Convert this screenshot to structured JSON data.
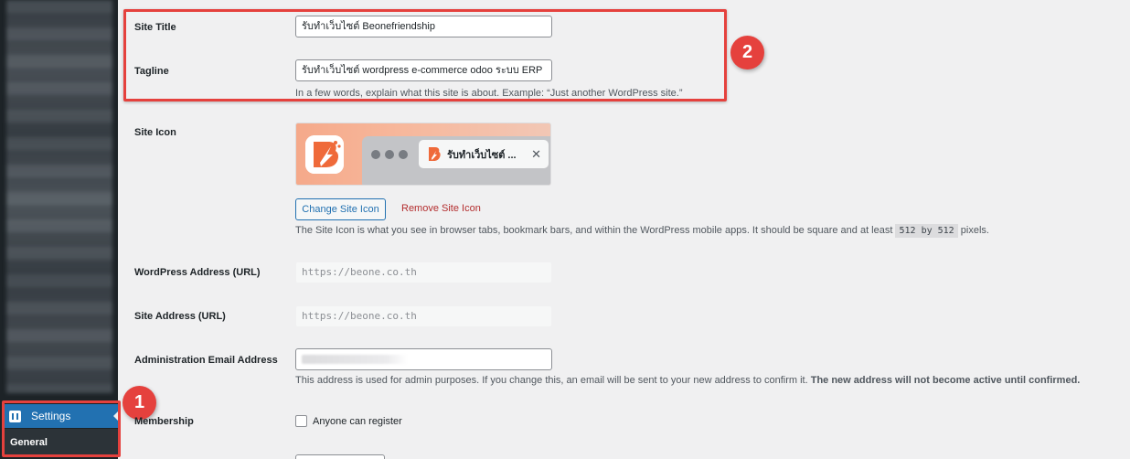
{
  "sidebar": {
    "settings_label": "Settings",
    "general_label": "General"
  },
  "form": {
    "site_title": {
      "label": "Site Title",
      "value": "รับทำเว็บไซต์ Beonefriendship"
    },
    "tagline": {
      "label": "Tagline",
      "value": "รับทำเว็บไซต์ wordpress e-commerce odoo ระบบ ERP",
      "description": "In a few words, explain what this site is about. Example: “Just another WordPress site.”"
    },
    "site_icon": {
      "label": "Site Icon",
      "preview_tab_title": "รับทำเว็บไซต์ ...",
      "close_glyph": "✕",
      "change_button": "Change Site Icon",
      "remove_link": "Remove Site Icon",
      "description_before": "The Site Icon is what you see in browser tabs, bookmark bars, and within the WordPress mobile apps. It should be square and at least ",
      "description_code": "512 by 512",
      "description_after": " pixels."
    },
    "wordpress_address": {
      "label": "WordPress Address (URL)",
      "value": "https://beone.co.th"
    },
    "site_address": {
      "label": "Site Address (URL)",
      "value": "https://beone.co.th"
    },
    "admin_email": {
      "label": "Administration Email Address",
      "description_normal": "This address is used for admin purposes. If you change this, an email will be sent to your new address to confirm it. ",
      "description_bold": "The new address will not become active until confirmed."
    },
    "membership": {
      "label": "Membership",
      "checkbox_label": "Anyone can register",
      "checked": false
    }
  },
  "annotations": {
    "badge_1": "1",
    "badge_2": "2",
    "color": "#e5413d"
  },
  "icons": {
    "settings": "settings-icon",
    "site_logo": "beone-logo-icon",
    "close": "close-icon"
  }
}
